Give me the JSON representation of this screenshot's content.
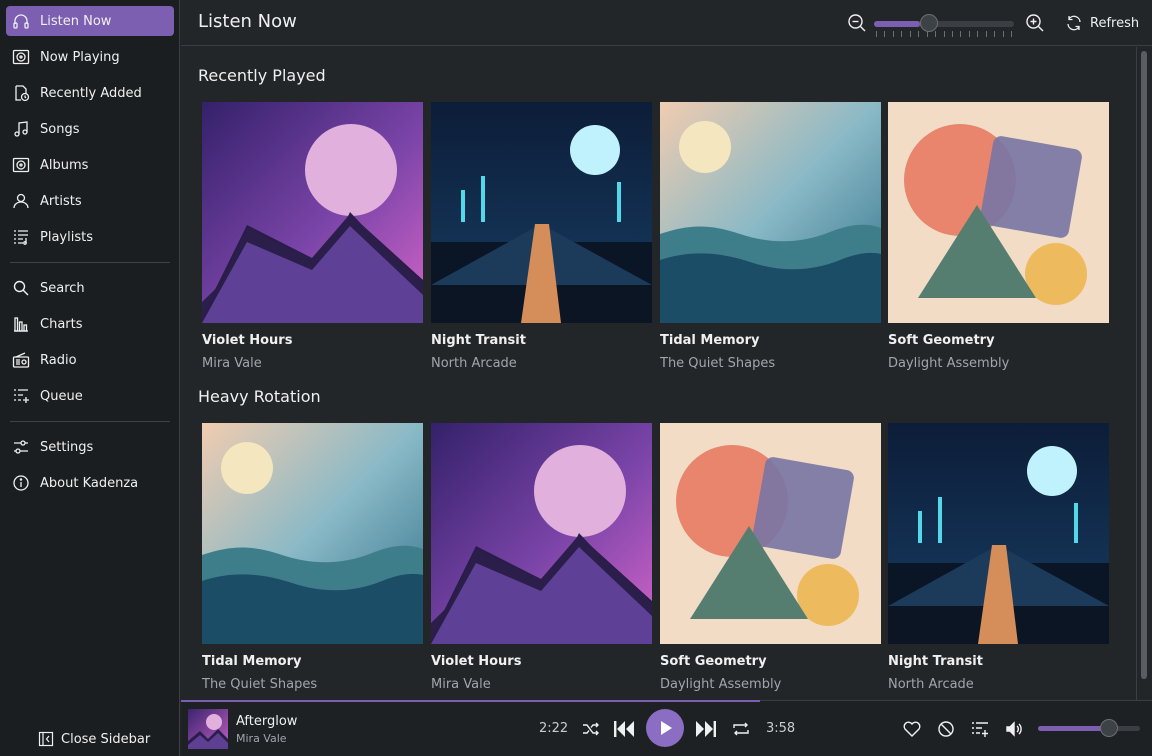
{
  "sidebar": {
    "items": [
      {
        "label": "Listen Now",
        "icon": "headphones-icon",
        "active": true
      },
      {
        "label": "Now Playing",
        "icon": "now-playing-icon"
      },
      {
        "label": "Recently Added",
        "icon": "recently-added-icon"
      },
      {
        "label": "Songs",
        "icon": "music-note-icon"
      },
      {
        "label": "Albums",
        "icon": "album-icon"
      },
      {
        "label": "Artists",
        "icon": "person-icon"
      },
      {
        "label": "Playlists",
        "icon": "playlist-icon"
      },
      {
        "label": "Search",
        "icon": "search-icon"
      },
      {
        "label": "Charts",
        "icon": "chart-icon"
      },
      {
        "label": "Radio",
        "icon": "radio-icon"
      },
      {
        "label": "Queue",
        "icon": "queue-icon"
      },
      {
        "label": "Settings",
        "icon": "settings-icon"
      },
      {
        "label": "About Kadenza",
        "icon": "info-icon"
      }
    ],
    "close_label": "Close Sidebar"
  },
  "header": {
    "title": "Listen Now",
    "zoom_level": 0.33,
    "refresh_label": "Refresh"
  },
  "main": {
    "sections": [
      {
        "title": "Recently Played",
        "albums": [
          {
            "title": "Violet Hours",
            "artist": "Mira Vale",
            "art": "violet"
          },
          {
            "title": "Night Transit",
            "artist": "North Arcade",
            "art": "night"
          },
          {
            "title": "Tidal Memory",
            "artist": "The Quiet Shapes",
            "art": "tidal"
          },
          {
            "title": "Soft Geometry",
            "artist": "Daylight Assembly",
            "art": "geometry"
          }
        ]
      },
      {
        "title": "Heavy Rotation",
        "albums": [
          {
            "title": "Tidal Memory",
            "artist": "The Quiet Shapes",
            "art": "tidal"
          },
          {
            "title": "Violet Hours",
            "artist": "Mira Vale",
            "art": "violet"
          },
          {
            "title": "Soft Geometry",
            "artist": "Daylight Assembly",
            "art": "geometry"
          },
          {
            "title": "Night Transit",
            "artist": "North Arcade",
            "art": "night"
          }
        ]
      }
    ]
  },
  "player": {
    "track_title": "Afterglow",
    "track_artist": "Mira Vale",
    "elapsed": "2:22",
    "duration": "3:58",
    "progress": 0.596,
    "volume": 0.7
  },
  "colors": {
    "accent": "#7c5fb0",
    "background": "#232629",
    "sidebar": "#1b1e20"
  }
}
